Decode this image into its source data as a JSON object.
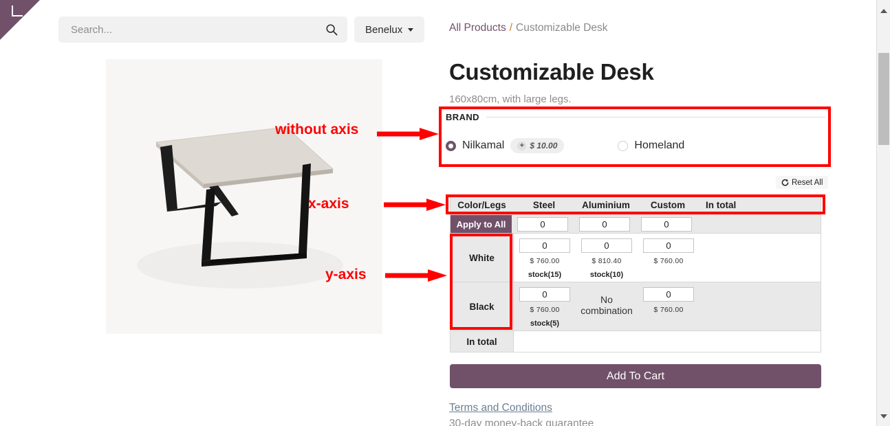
{
  "header": {
    "search": {
      "placeholder": "Search...",
      "value": "",
      "icon": "search-icon"
    },
    "region_selector": {
      "label": "Benelux",
      "icon": "chevron-down-icon"
    },
    "corner_ribbon_icon": "corner-bracket-icon"
  },
  "breadcrumb": {
    "root": "All Products",
    "separator": "/",
    "current": "Customizable Desk"
  },
  "product": {
    "title": "Customizable Desk",
    "subtitle": "160x80cm, with large legs.",
    "image_alt": "customizable-desk-photo"
  },
  "brand": {
    "section_label": "BRAND",
    "options": [
      {
        "label": "Nilkamal",
        "selected": true,
        "price_badge": "$ 10.00",
        "badge_prefix": "+"
      },
      {
        "label": "Homeland",
        "selected": false,
        "price_badge": ""
      }
    ]
  },
  "reset": {
    "label": "Reset All",
    "icon": "refresh-icon"
  },
  "matrix": {
    "headers": [
      "Color/Legs",
      "Steel",
      "Aluminium",
      "Custom",
      "In total"
    ],
    "apply_row": {
      "button_label": "Apply to All",
      "values": [
        "0",
        "0",
        "0"
      ]
    },
    "rows": [
      {
        "label": "White",
        "cells": [
          {
            "value": "0",
            "price": "$ 760.00",
            "stock": "stock(15)",
            "available": true
          },
          {
            "value": "0",
            "price": "$ 810.40",
            "stock": "stock(10)",
            "available": true
          },
          {
            "value": "0",
            "price": "$ 760.00",
            "stock": "",
            "available": true
          }
        ]
      },
      {
        "label": "Black",
        "cells": [
          {
            "value": "0",
            "price": "$ 760.00",
            "stock": "stock(5)",
            "available": true
          },
          {
            "value": "",
            "price": "",
            "stock": "",
            "available": false,
            "unavailable_text": "No combination"
          },
          {
            "value": "0",
            "price": "$ 760.00",
            "stock": "",
            "available": true
          }
        ]
      }
    ],
    "total_row_label": "In total"
  },
  "cart": {
    "button_label": "Add To Cart"
  },
  "footer": {
    "terms_link": "Terms and Conditions",
    "guarantee": "30-day money-back guarantee"
  },
  "annotations": [
    {
      "id": "without-axis",
      "label": "without axis"
    },
    {
      "id": "x-axis",
      "label": "x-axis"
    },
    {
      "id": "y-axis",
      "label": "y-axis"
    }
  ],
  "colors": {
    "accent_purple": "#71516a",
    "annotation_red": "#ff0000",
    "header_gray": "#e9e9e9",
    "breadcrumb_sep": "#c9772a",
    "link_blue_gray": "#6b7f91"
  },
  "scrollbar": {
    "up_icon": "triangle-up-icon",
    "down_icon": "triangle-down-icon"
  }
}
